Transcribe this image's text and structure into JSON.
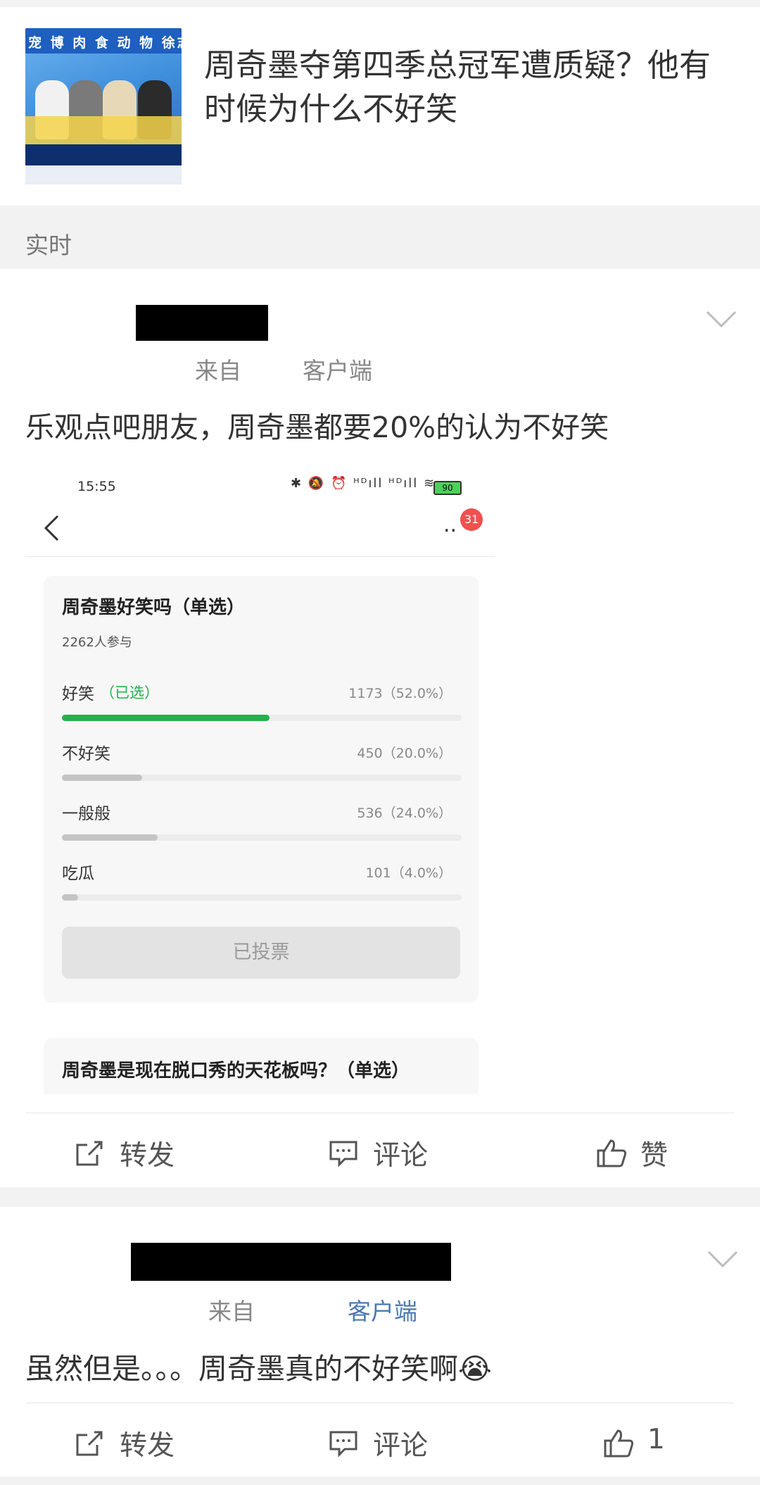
{
  "header": {
    "thumbnail_text": "宠 博 肉 食 动 物 徐志胜",
    "title": "周奇墨夺第四季总冠军遭质疑？他有时候为什么不好笑"
  },
  "section": {
    "label": "实时"
  },
  "post1": {
    "source_prefix": "来自",
    "source_client": "客户端",
    "text": "乐观点吧朋友，周奇墨都要20%的认为不好笑",
    "screenshot": {
      "status_time": "15:55",
      "status_icons": "✱ 🔕 ⏰ ᴴᴰıll ᴴᴰıll ≋",
      "battery": "90",
      "more": "..",
      "badge_count": "31",
      "poll": {
        "question": "周奇墨好笑吗（单选）",
        "participants": "2262人参与",
        "chosen_label": "（已选）",
        "options": [
          {
            "label": "好笑",
            "count_text": "1173（52.0%）",
            "percent": 52.0,
            "color": "#22b14c"
          },
          {
            "label": "不好笑",
            "count_text": "450（20.0%）",
            "percent": 20.0,
            "color": "#c4c4c4"
          },
          {
            "label": "一般般",
            "count_text": "536（24.0%）",
            "percent": 24.0,
            "color": "#c4c4c4"
          },
          {
            "label": "吃瓜",
            "count_text": "101（4.0%）",
            "percent": 4.0,
            "color": "#c4c4c4"
          }
        ],
        "voted_button": "已投票"
      },
      "poll2_question": "周奇墨是现在脱口秀的天花板吗？（单选）"
    },
    "actions": {
      "repost": "转发",
      "comment": "评论",
      "like": "赞"
    }
  },
  "post2": {
    "source_prefix": "来自",
    "source_client": "客户端",
    "text": "虽然但是。。。周奇墨真的不好笑啊",
    "emoji": "😭",
    "actions": {
      "repost": "转发",
      "comment": "评论",
      "like_count": "1"
    }
  }
}
